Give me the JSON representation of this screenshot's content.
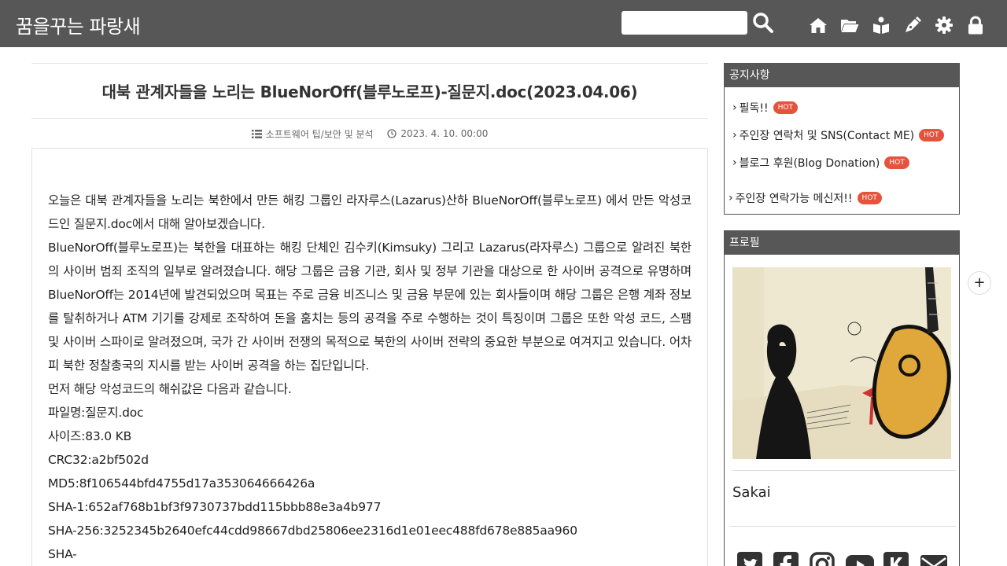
{
  "header": {
    "site_title": "꿈을꾸는 파랑새",
    "search": {
      "value": "",
      "placeholder": ""
    },
    "nav_icons": [
      "home-icon",
      "folder-icon",
      "guestbook-icon",
      "write-icon",
      "settings-icon",
      "lock-icon"
    ]
  },
  "post": {
    "title": "대북 관계자들을 노리는 BlueNorOff(블루노로프)-질문지.doc(2023.04.06)",
    "category": "소프트웨어 팁/보안 및 분석",
    "date": "2023. 4. 10. 00:00",
    "paragraphs": [
      "오늘은 대북 관계자들을 노리는 북한에서 만든 해킹 그룹인 라자루스(Lazarus)산하 BlueNorOff(블루노로프) 에서 만든 악성코드인 질문지.doc에서 대해 알아보겠습니다.",
      "BlueNorOff(블루노로프)는 북한을 대표하는 해킹 단체인 김수키(Kimsuky) 그리고 Lazarus(라자루스) 그룹으로 알려진 북한의 사이버 범죄 조직의 일부로 알려졌습니다. 해당 그룹은 금융 기관, 회사 및 정부 기관을 대상으로 한 사이버 공격으로 유명하며 BlueNorOff는 2014년에 발견되었으며 목표는 주로 금융 비즈니스 및 금융 부문에 있는 회사들이며 해당 그룹은 은행 계좌 정보를 탈취하거나 ATM 기기를 강제로 조작하여 돈을 훔치는 등의 공격을 주로 수행하는 것이 특징이며 그룹은 또한 악성 코드, 스팸 및 사이버 스파이로 알려졌으며, 국가 간 사이버 전쟁의 목적으로 북한의 사이버 전략의 중요한 부분으로 여겨지고 있습니다. 어차피 북한 정찰총국의 지시를 받는 사이버 공격을 하는 집단입니다.",
      "먼저 해당 악성코드의 해쉬값은 다음과 같습니다.",
      "파일명:질문지.doc",
      "사이즈:83.0 KB",
      "CRC32:a2bf502d",
      "MD5:8f106544bfd4755d17a353064666426a",
      "SHA-1:652af768b1bf3f9730737bdd115bbb88e3a4b977",
      "SHA-256:3252345b2640efc44cdd98667dbd25806ee2316d1e01eec488fd678e885aa960",
      "SHA-"
    ]
  },
  "sidebar": {
    "notice": {
      "title": "공지사항",
      "items": [
        {
          "label": "필독!!",
          "badge": "HOT"
        },
        {
          "label": "주인장 연락처 및 SNS(Contact ME)",
          "badge": "HOT"
        },
        {
          "label": "블로그 후원(Blog Donation)",
          "badge": "HOT"
        },
        {
          "label": "주인장 연락가능 메신저!!",
          "badge": "HOT"
        }
      ]
    },
    "profile": {
      "title": "프로필",
      "name": "Sakai",
      "social_icons": [
        "twitter-icon",
        "facebook-icon",
        "instagram-icon",
        "youtube-icon",
        "kakao-icon",
        "mail-icon"
      ]
    }
  },
  "colors": {
    "header_bg": "#575757",
    "hot_badge": "#e5533d"
  }
}
